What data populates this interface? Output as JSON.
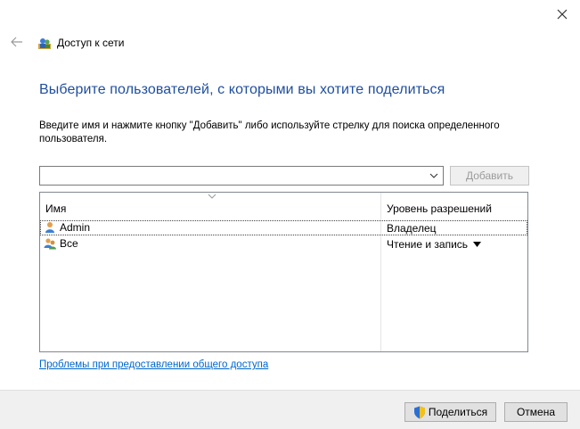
{
  "window": {
    "title": "Доступ к сети",
    "close_icon": "close-icon",
    "back_icon": "back-arrow-icon"
  },
  "main": {
    "heading": "Выберите пользователей, с которыми вы хотите поделиться",
    "instruction": "Введите имя и нажмите кнопку \"Добавить\" либо используйте стрелку для поиска определенного пользователя.",
    "combo": {
      "value": "",
      "placeholder": ""
    },
    "add_label": "Добавить"
  },
  "table": {
    "columns": [
      "Имя",
      "Уровень разрешений"
    ],
    "rows": [
      {
        "name": "Admin",
        "permission": "Владелец",
        "icon": "user-icon",
        "selected": true
      },
      {
        "name": "Все",
        "permission": "Чтение и запись",
        "icon": "group-icon",
        "has_dropdown": true
      }
    ]
  },
  "help_link": "Проблемы при предоставлении общего доступа",
  "footer": {
    "share_label": "Поделиться",
    "cancel_label": "Отмена"
  },
  "colors": {
    "heading": "#1f4e9e",
    "link": "#0066cc",
    "footer_bg": "#f0f0f0"
  }
}
